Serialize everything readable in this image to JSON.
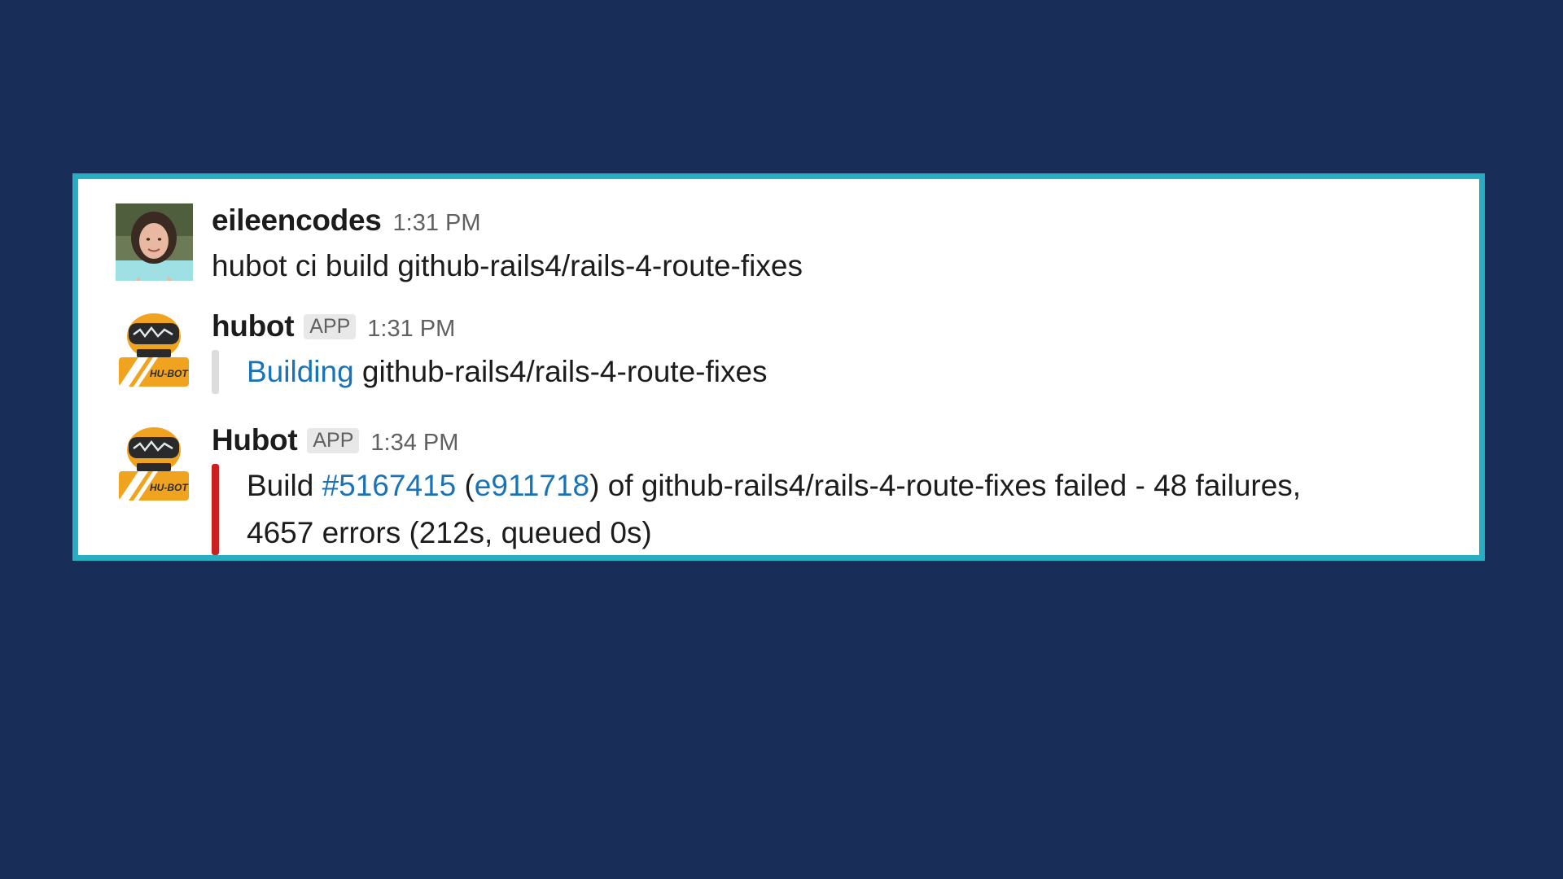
{
  "messages": [
    {
      "author": "eileencodes",
      "time": "1:31 PM",
      "text": "hubot ci build github-rails4/rails-4-route-fixes"
    },
    {
      "author": "hubot",
      "badge": "APP",
      "time": "1:31 PM",
      "attachment": {
        "link_text": "Building",
        "rest_text": " github-rails4/rails-4-route-fixes",
        "bar_color": "#dddddd"
      }
    },
    {
      "author": "Hubot",
      "badge": "APP",
      "time": "1:34 PM",
      "attachment": {
        "prefix": "Build ",
        "build_link": "#5167415",
        "paren_open": " (",
        "commit_link": "e911718",
        "line1_rest": ") of github-rails4/rails-4-route-fixes failed - 48 failures,",
        "line2": "4657 errors (212s, queued 0s)",
        "bar_color": "#cc1f1f"
      }
    }
  ],
  "colors": {
    "background": "#182e59",
    "panel_border": "#27aec3",
    "link": "#1a73b7"
  },
  "icons": {
    "user_avatar": "user-avatar-photo",
    "bot_avatar": "hubot-robot-icon"
  }
}
